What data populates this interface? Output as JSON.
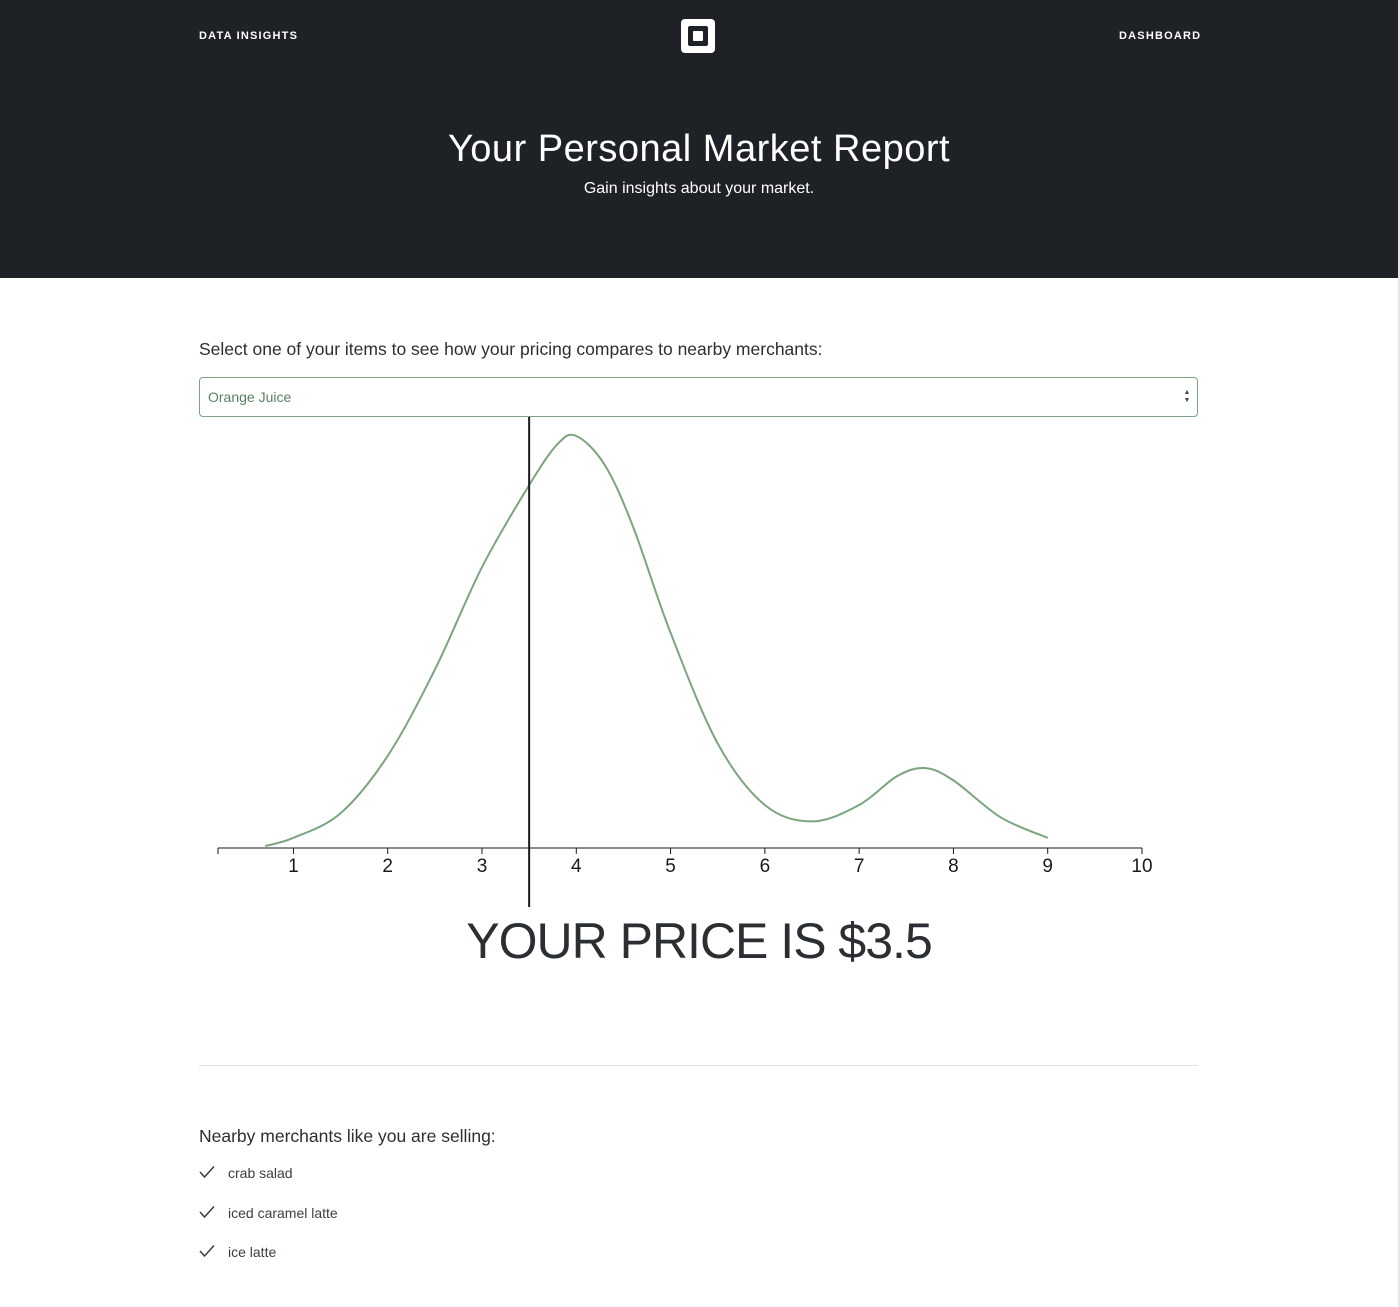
{
  "nav": {
    "left_link": "DATA INSIGHTS",
    "right_link": "DASHBOARD",
    "logo_icon": "square-logo-icon"
  },
  "hero": {
    "title": "Your Personal Market Report",
    "subtitle": "Gain insights about your market."
  },
  "selector": {
    "prompt": "Select one of your items to see how your pricing compares to nearby merchants:",
    "selected_value": "Orange Juice",
    "arrow_icon": "select-arrows-icon"
  },
  "chart_data": {
    "type": "line",
    "x": [
      0.7,
      1.0,
      1.5,
      2.0,
      2.5,
      3.0,
      3.5,
      3.8,
      4.0,
      4.3,
      4.6,
      5.0,
      5.5,
      6.0,
      6.5,
      7.0,
      7.4,
      7.7,
      8.0,
      8.5,
      9.0
    ],
    "series": [
      {
        "values": [
          0.0,
          0.02,
          0.08,
          0.22,
          0.43,
          0.68,
          0.88,
          0.98,
          1.0,
          0.93,
          0.78,
          0.52,
          0.25,
          0.1,
          0.06,
          0.1,
          0.17,
          0.19,
          0.16,
          0.07,
          0.02
        ]
      }
    ],
    "xticks": [
      1,
      2,
      3,
      4,
      5,
      6,
      7,
      8,
      9,
      10
    ],
    "xlim": [
      0.2,
      10
    ],
    "ylim": [
      0,
      1
    ],
    "marker_value": 3.5,
    "line_color": "#7ba57f",
    "marker_color": "#1a1a1a",
    "grid": false
  },
  "price": {
    "label": "YOUR PRICE IS $3.5"
  },
  "merchants": {
    "heading": "Nearby merchants like you are selling:",
    "check_icon": "checkmark-icon",
    "items": [
      "crab salad",
      "iced caramel latte",
      "ice latte"
    ]
  },
  "colors": {
    "hero_background": "#1e2226",
    "accent_green": "#7aa585",
    "text_dark": "#2b2f33"
  }
}
